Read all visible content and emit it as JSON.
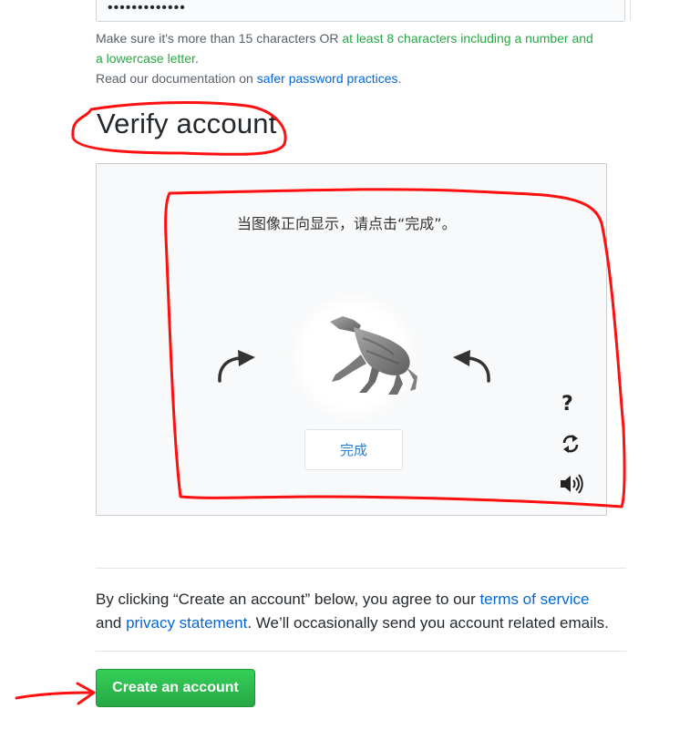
{
  "password": {
    "masked_value": "•••••••••••••"
  },
  "notes": {
    "line1_prefix": "Make sure it's more than 15 characters OR ",
    "line1_green": "at least 8 characters including a number and",
    "line2_green": "a lowercase letter",
    "line2_suffix": ".",
    "line3_prefix": "Read our documentation on ",
    "line3_link": "safer password practices",
    "line3_suffix": "."
  },
  "verify": {
    "title": "Verify account",
    "captcha": {
      "prompt": "当图像正向显示，请点击“完成”。",
      "done_label": "完成",
      "help_symbol": "?",
      "rotate_left_icon": "rotate-left-icon",
      "rotate_right_icon": "rotate-right-icon",
      "refresh_icon": "refresh-icon",
      "audio_icon": "audio-icon"
    }
  },
  "legal": {
    "part1": "By clicking “Create an account” below, you agree to our ",
    "terms_link": "terms of service",
    "part2": "and ",
    "privacy_link": "privacy statement",
    "part3": ". We’ll occasionally send you account related emails."
  },
  "submit": {
    "label": "Create an account"
  },
  "colors": {
    "annotation": "#ff1010",
    "primary_button": "#2ea44f",
    "link": "#0366d6",
    "hint_green": "#28a745"
  }
}
